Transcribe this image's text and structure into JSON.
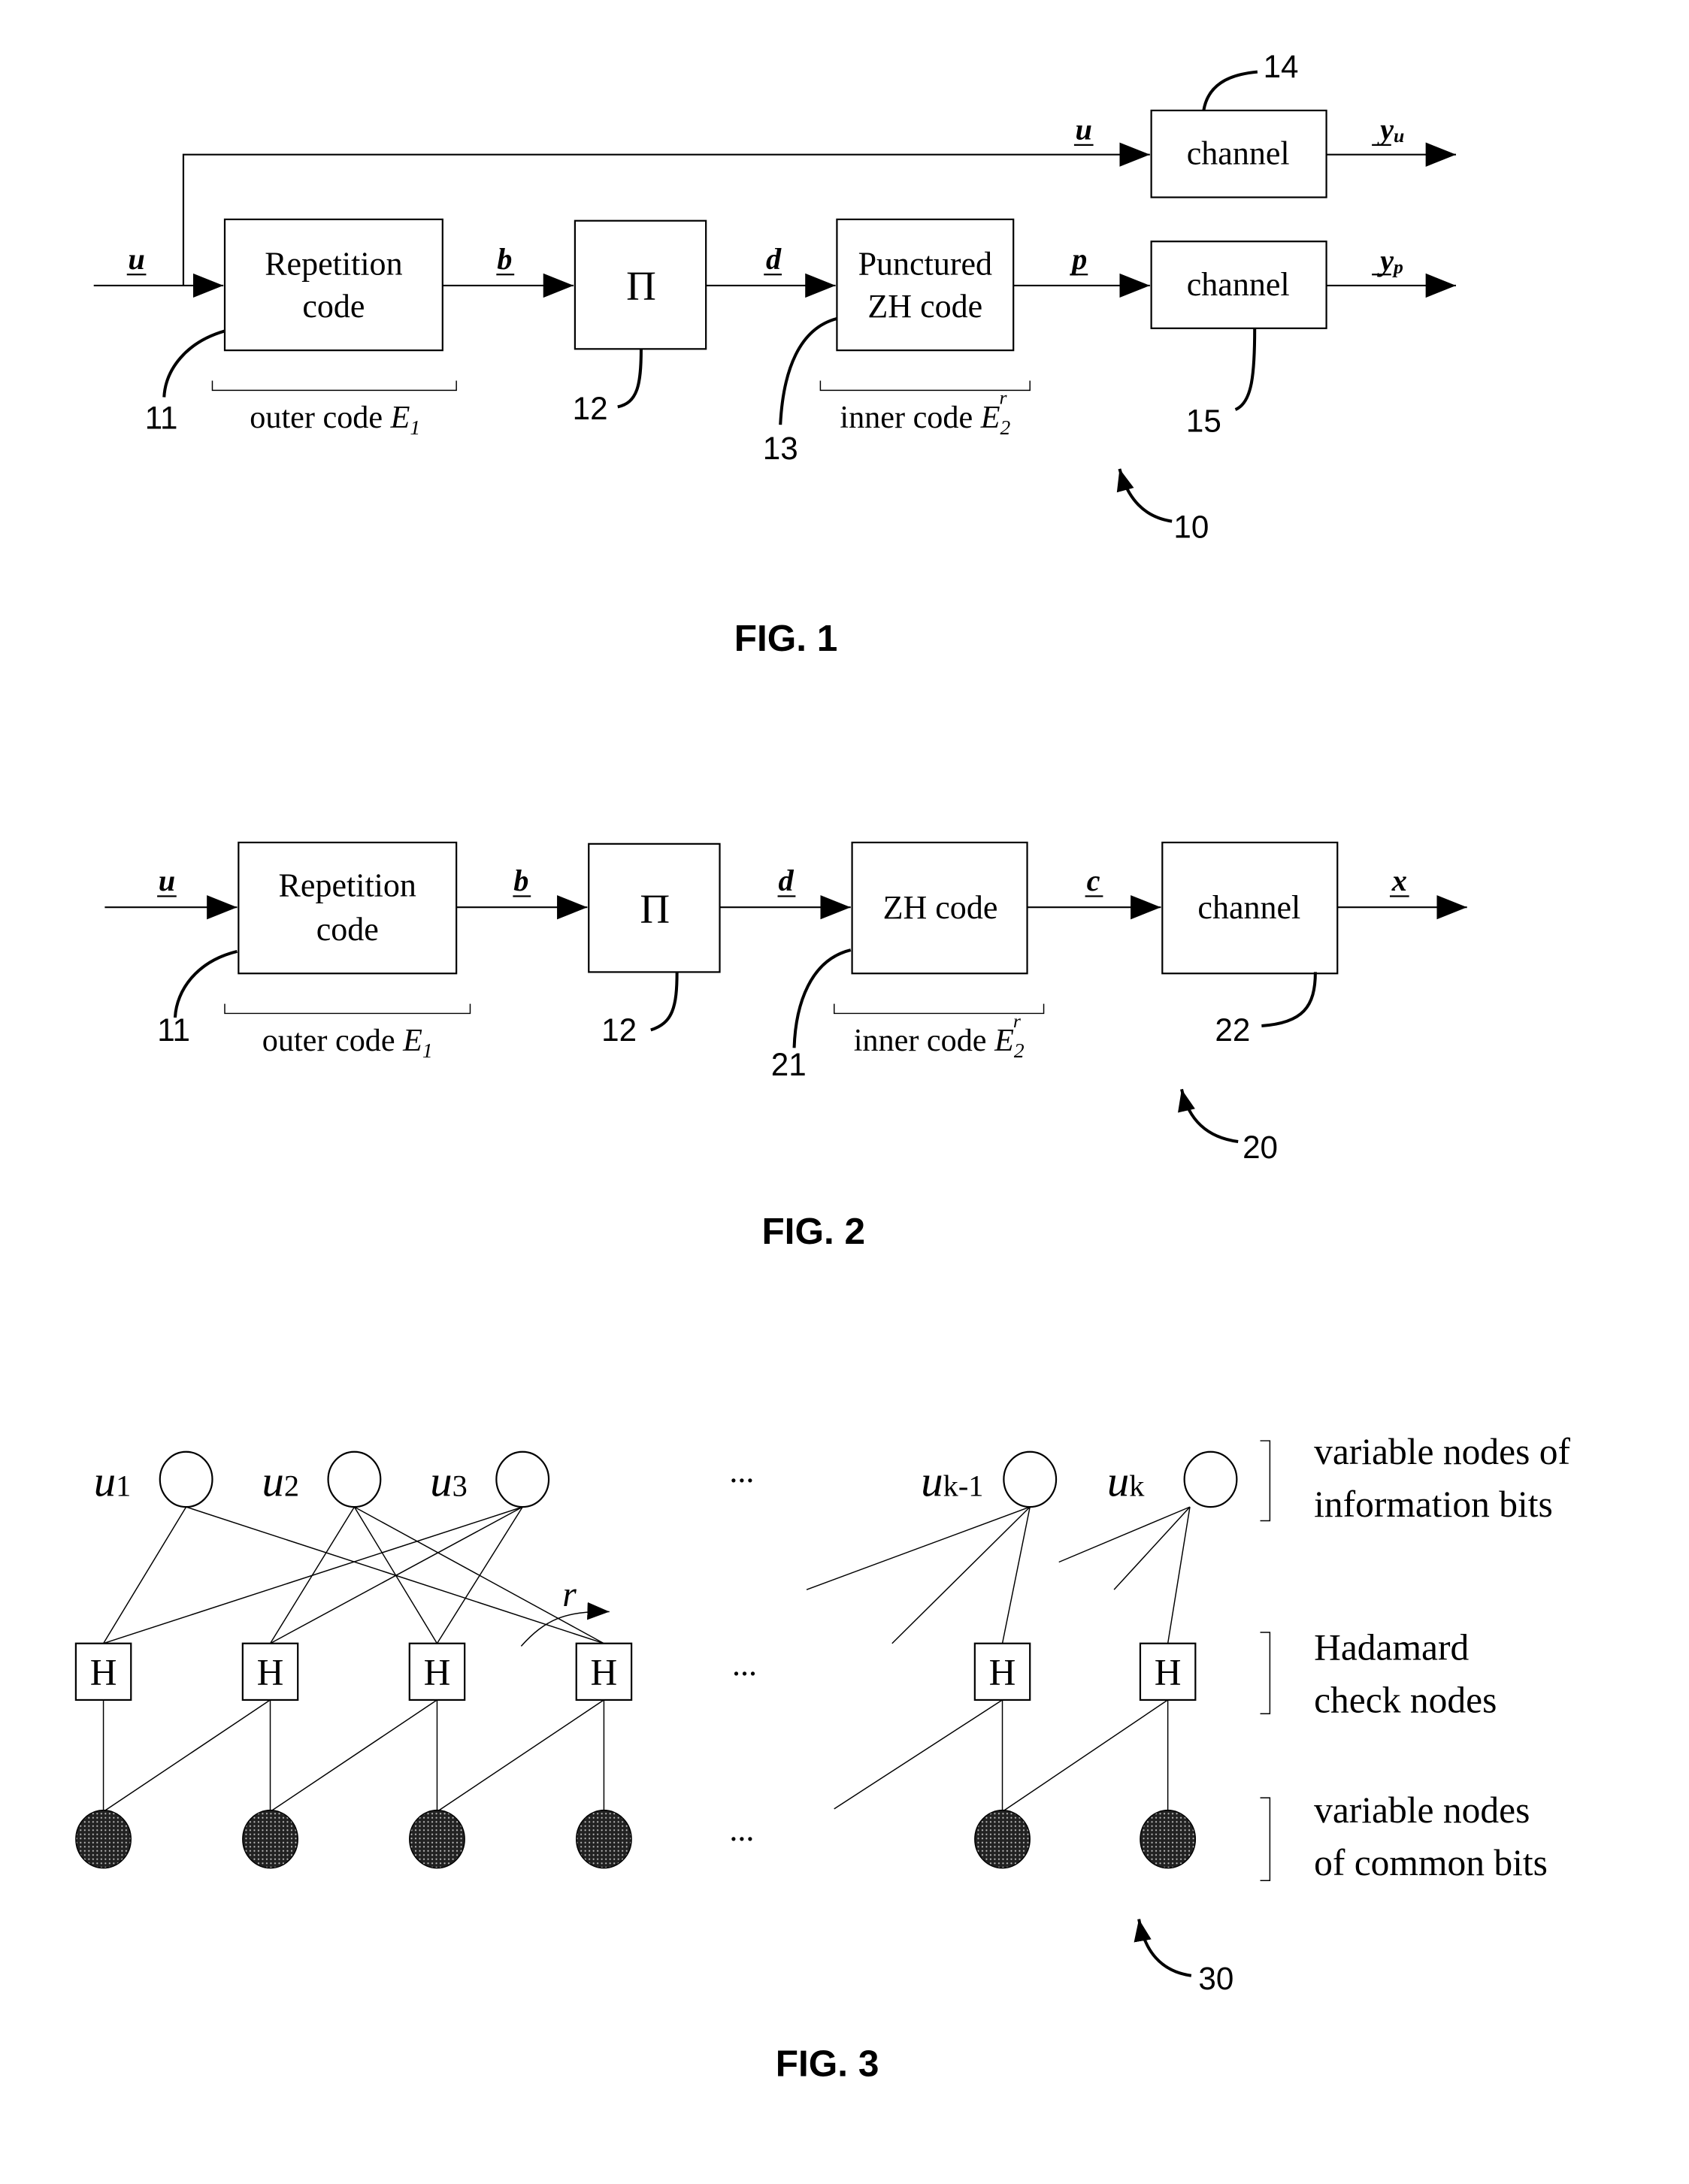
{
  "fig1": {
    "caption": "FIG. 1",
    "ref_system": "10",
    "blocks": {
      "repetition_line1": "Repetition",
      "repetition_line2": "code",
      "interleaver": "Π",
      "zh_line1": "Punctured",
      "zh_line2": "ZH code",
      "channel_top": "channel",
      "channel_bottom": "channel"
    },
    "signals": {
      "input": "u",
      "top_branch": "u",
      "after_repetition": "b",
      "after_interleaver": "d",
      "after_zh": "p",
      "out_top": "y",
      "out_top_sub": "u",
      "out_bottom": "y",
      "out_bottom_sub": "p"
    },
    "refs": {
      "repetition": "11",
      "interleaver": "12",
      "zh": "13",
      "channel_top": "14",
      "channel_bottom": "15"
    },
    "brackets": {
      "outer": "outer code ",
      "outer_sym": "E",
      "outer_sub": "1",
      "inner": "inner code ",
      "inner_sym": "E",
      "inner_sub": "2",
      "inner_sup": "r"
    }
  },
  "fig2": {
    "caption": "FIG. 2",
    "ref_system": "20",
    "blocks": {
      "repetition_line1": "Repetition",
      "repetition_line2": "code",
      "interleaver": "Π",
      "zh": "ZH code",
      "channel": "channel"
    },
    "signals": {
      "input": "u",
      "after_repetition": "b",
      "after_interleaver": "d",
      "after_zh": "c",
      "output": "x"
    },
    "refs": {
      "repetition": "11",
      "interleaver": "12",
      "zh": "21",
      "channel": "22"
    },
    "brackets": {
      "outer": "outer code ",
      "outer_sym": "E",
      "outer_sub": "1",
      "inner": "inner code ",
      "inner_sym": "E",
      "inner_sub": "2",
      "inner_sup": "r"
    }
  },
  "fig3": {
    "caption": "FIG. 3",
    "ref_system": "30",
    "info_nodes": [
      {
        "sym": "u",
        "sub": "1"
      },
      {
        "sym": "u",
        "sub": "2"
      },
      {
        "sym": "u",
        "sub": "3"
      },
      {
        "sym": "u",
        "sub": "k-1"
      },
      {
        "sym": "u",
        "sub": "k"
      }
    ],
    "check_label": "H",
    "ellipsis": "...",
    "rotation_label": "r",
    "legend": {
      "info_line1": "variable nodes of",
      "info_line2": "information bits",
      "check_line1": "Hadamard",
      "check_line2": "check nodes",
      "common_line1": "variable nodes",
      "common_line2": "of common bits"
    }
  }
}
